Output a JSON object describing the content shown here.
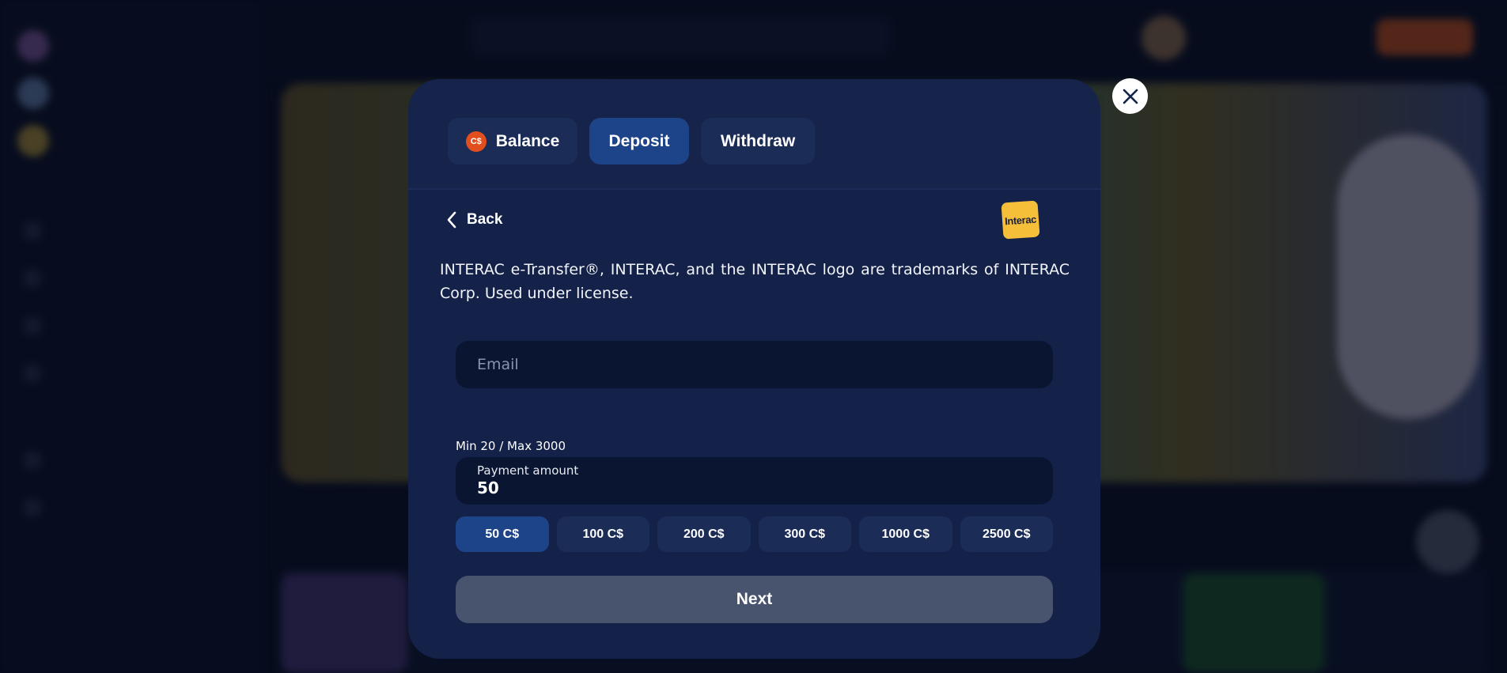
{
  "modal": {
    "tabs": [
      {
        "label": "Balance",
        "currency_badge": "C$",
        "active": false
      },
      {
        "label": "Deposit",
        "active": true
      },
      {
        "label": "Withdraw",
        "active": false
      }
    ],
    "back_label": "Back",
    "payment_logo_text": "Interac",
    "legal_text": "INTERAC e-Transfer®, INTERAC, and the INTERAC logo are trademarks of INTERAC Corp. Used under license.",
    "email": {
      "placeholder": "Email",
      "value": ""
    },
    "limits_text": "Min 20 / Max 3000",
    "amount": {
      "label": "Payment amount",
      "value": "50"
    },
    "presets": [
      {
        "label": "50 C$",
        "active": true
      },
      {
        "label": "100 C$",
        "active": false
      },
      {
        "label": "200 C$",
        "active": false
      },
      {
        "label": "300 C$",
        "active": false
      },
      {
        "label": "1000 C$",
        "active": false
      },
      {
        "label": "2500 C$",
        "active": false
      }
    ],
    "next_label": "Next",
    "close_icon": "close-icon"
  },
  "colors": {
    "modal_bg": "#14224a",
    "tab_active": "#1d4488",
    "tab_inactive": "#1b2c57",
    "input_bg": "#0a1531",
    "next_disabled": "#48536e",
    "interac_yellow": "#f6bf3a",
    "currency_orange": "#e24f1f"
  }
}
